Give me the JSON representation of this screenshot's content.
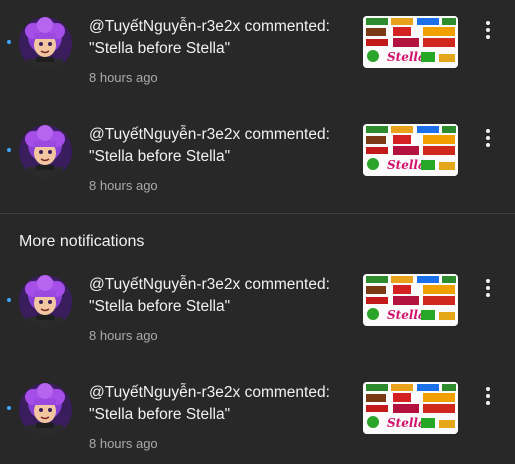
{
  "section_heading": "More notifications",
  "notifications": [
    {
      "text": "@TuyếtNguyễn-r3e2x commented: \"Stella before Stella\"",
      "time": "8 hours ago",
      "unread": true
    },
    {
      "text": "@TuyếtNguyễn-r3e2x commented: \"Stella before Stella\"",
      "time": "8 hours ago",
      "unread": true
    },
    {
      "text": "@TuyếtNguyễn-r3e2x commented: \"Stella before Stella\"",
      "time": "8 hours ago",
      "unread": true
    },
    {
      "text": "@TuyếtNguyễn-r3e2x commented: \"Stella before Stella\"",
      "time": "8 hours ago",
      "unread": true
    }
  ],
  "thumbnail": {
    "caption": "Stella"
  },
  "colors": {
    "background": "#282828",
    "unread_dot": "#3ea6ff",
    "text": "#f1f1f1",
    "muted": "#aaaaaa"
  }
}
